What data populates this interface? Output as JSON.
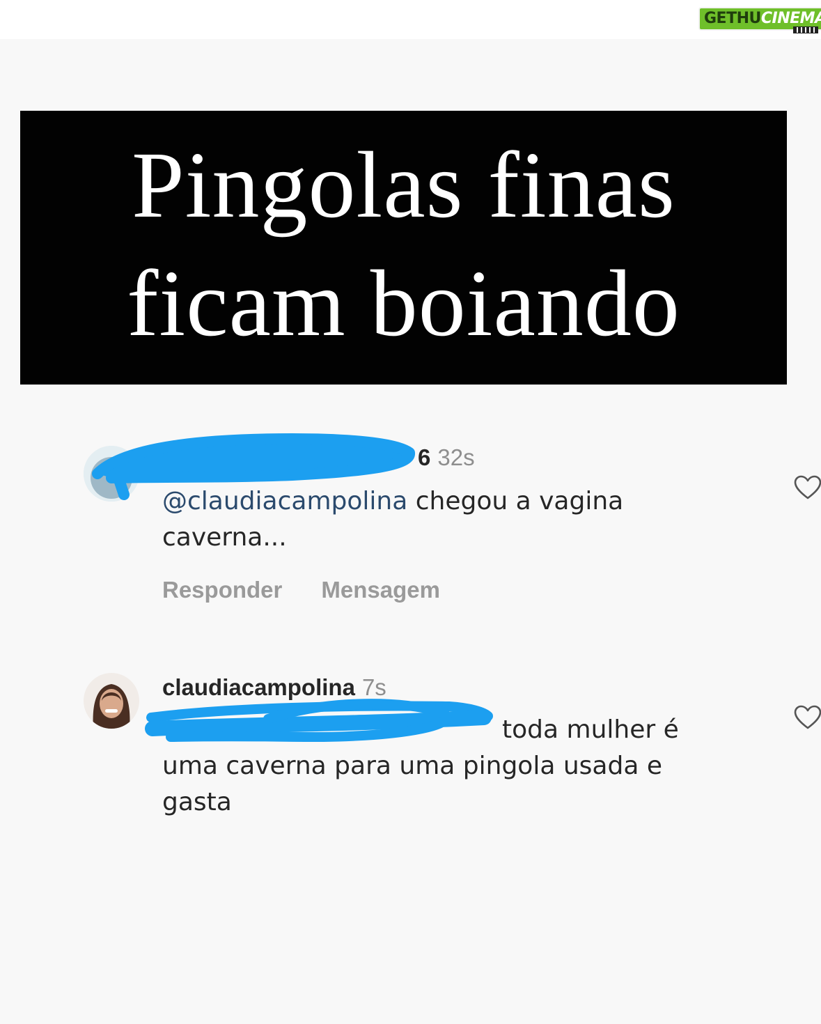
{
  "watermark": {
    "part1": "GETHU",
    "part2": "CINEMA"
  },
  "banner": {
    "line1": "Pingolas finas",
    "line2": "ficam boiando"
  },
  "comments": [
    {
      "username_visible": "6",
      "time": "32s",
      "mention": "@claudiacampolina",
      "text_line1": " chegou a vagina",
      "text_line2": "caverna...",
      "reply_label": "Responder",
      "message_label": "Mensagem"
    },
    {
      "username": "claudiacampolina",
      "time": "7s",
      "text_line1": "toda mulher é",
      "text_line2": "uma caverna para uma pingola usada e",
      "text_line3": "gasta"
    }
  ],
  "colors": {
    "redaction": "#1c9ff0",
    "banner_bg": "#020202",
    "page_bg": "#f8f8f8"
  },
  "icons": [
    "heart-icon",
    "heart-icon"
  ]
}
